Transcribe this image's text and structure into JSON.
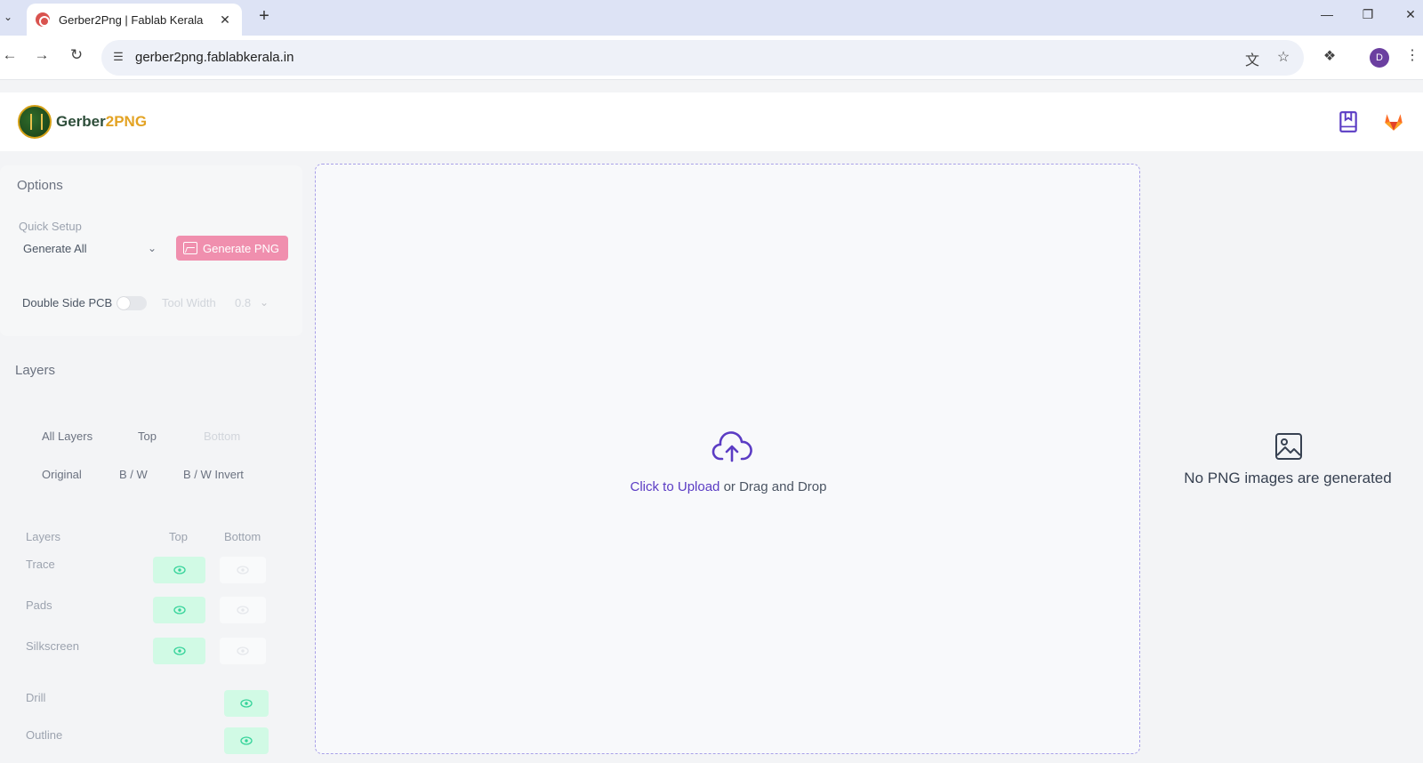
{
  "browser": {
    "tab_title": "Gerber2Png | Fablab Kerala",
    "url": "gerber2png.fablabkerala.in",
    "profile_initial": "D"
  },
  "header": {
    "brand_main": "Gerber",
    "brand_num": "2",
    "brand_accent": "PNG"
  },
  "options": {
    "title": "Options",
    "quick_setup_label": "Quick Setup",
    "quick_setup_value": "Generate All",
    "generate_button": "Generate PNG",
    "double_side_label": "Double Side PCB",
    "double_side_on": false,
    "tool_width_label": "Tool Width",
    "tool_width_value": "0.8"
  },
  "layers": {
    "title": "Layers",
    "side_tabs": [
      "All Layers",
      "Top",
      "Bottom"
    ],
    "color_tabs": [
      "Original",
      "B / W",
      "B / W Invert"
    ],
    "table_headers": [
      "Layers",
      "Top",
      "Bottom"
    ],
    "rows": [
      {
        "name": "Trace",
        "top": true,
        "bottom": false
      },
      {
        "name": "Pads",
        "top": true,
        "bottom": false
      },
      {
        "name": "Silkscreen",
        "top": true,
        "bottom": false
      }
    ],
    "extra_rows": [
      {
        "name": "Drill",
        "on": true
      },
      {
        "name": "Outline",
        "on": true
      }
    ]
  },
  "upload": {
    "link_text": "Click to Upload",
    "rest_text": " or Drag and Drop"
  },
  "preview": {
    "empty_text": "No PNG images are generated"
  },
  "colors": {
    "accent": "#5b3cc4",
    "generate_button": "#f08fae",
    "eye_on": "#d1fae5",
    "brand_orange": "#e3a324"
  }
}
